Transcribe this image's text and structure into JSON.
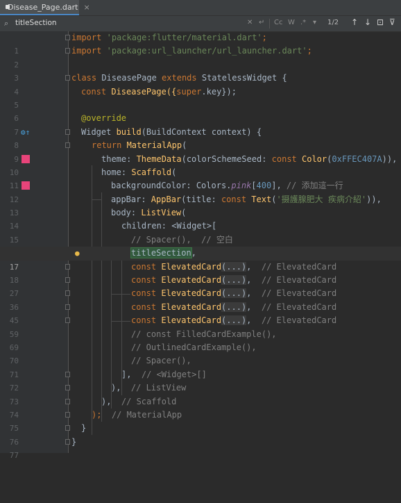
{
  "tab": {
    "filename": "Disease_Page.dart",
    "close": "×"
  },
  "search": {
    "query": "titleSection",
    "match_count": "1/2",
    "opts": {
      "cc": "Cc",
      "w": "W",
      "regex": ".*"
    }
  },
  "editor": {
    "lines": [
      {
        "n": "1"
      },
      {
        "n": "2"
      },
      {
        "n": "3"
      },
      {
        "n": "4"
      },
      {
        "n": "5"
      },
      {
        "n": "6"
      },
      {
        "n": "7"
      },
      {
        "n": "8"
      },
      {
        "n": "9"
      },
      {
        "n": "10"
      },
      {
        "n": "11"
      },
      {
        "n": "12"
      },
      {
        "n": "13"
      },
      {
        "n": "14"
      },
      {
        "n": "15"
      },
      {
        "n": "16"
      },
      {
        "n": "17"
      },
      {
        "n": "18"
      },
      {
        "n": "27"
      },
      {
        "n": "36"
      },
      {
        "n": "45"
      },
      {
        "n": "59"
      },
      {
        "n": "69"
      },
      {
        "n": "70"
      },
      {
        "n": "71"
      },
      {
        "n": "72"
      },
      {
        "n": "73"
      },
      {
        "n": "74"
      },
      {
        "n": "75"
      },
      {
        "n": "76"
      },
      {
        "n": "77"
      }
    ],
    "code": {
      "l1": {
        "kw": "import",
        "str": "'package:flutter/material.dart'",
        "end": ";"
      },
      "l2": {
        "kw": "import",
        "str": "'package:url_launcher/url_launcher.dart'",
        "end": ";"
      },
      "l4": {
        "kw1": "class",
        "name": " DiseasePage ",
        "kw2": "extends",
        "rest": " StatelessWidget {"
      },
      "l5": {
        "kw": "const",
        "name": " DiseasePage({",
        "sup": "super",
        "rest": ".key});"
      },
      "l7": {
        "ann": "@override"
      },
      "l8": {
        "a": "Widget ",
        "fn": "build",
        "b": "(BuildContext context) {"
      },
      "l9": {
        "kw": "return",
        "cls": " MaterialApp",
        "b": "("
      },
      "l10": {
        "a": "theme: ",
        "cls": "ThemeData",
        "b": "(colorSchemeSeed: ",
        "kw": "const",
        "cls2": " Color",
        "c": "(",
        "num": "0xFFEC407A",
        "d": ")),"
      },
      "l11": {
        "a": "home: ",
        "cls": "Scaffold",
        "b": "("
      },
      "l12": {
        "a": "backgroundColor: Colors.",
        "field": "pink",
        "b": "[",
        "num": "400",
        "c": "], ",
        "cm": "// 添加這一行"
      },
      "l13": {
        "a": "appBar: ",
        "cls": "AppBar",
        "b": "(title: ",
        "kw": "const",
        "cls2": " Text",
        "c": "(",
        "str": "'摄護腺肥大 疾病介紹'",
        "d": ")),"
      },
      "l14": {
        "a": "body: ",
        "cls": "ListView",
        "b": "("
      },
      "l15": {
        "a": "children: <Widget>["
      },
      "l16": {
        "cm": "// Spacer(),  // 空白"
      },
      "l17": {
        "hl": "titleSection",
        "b": ","
      },
      "cards": {
        "kw": "const",
        "cls": " ElevatedCard",
        "ph": "(...)",
        "b": ",  ",
        "cm": "// ElevatedCard"
      },
      "l69": {
        "cm": "// const FilledCardExample(),"
      },
      "l70": {
        "cm": "// OutlinedCardExample(),"
      },
      "l71": {
        "cm": "// Spacer(),"
      },
      "l72": {
        "a": "],  ",
        "cm": "// <Widget>[]"
      },
      "l73": {
        "a": "),  ",
        "cm": "// ListView"
      },
      "l74": {
        "a": "),  ",
        "cm": "// Scaffold"
      },
      "l75": {
        "a": ");  ",
        "cm": "// MaterialApp"
      },
      "l76": {
        "a": "}"
      },
      "l77": {
        "a": "}"
      }
    }
  },
  "colors": {
    "background": "#2b2b2b",
    "gutter": "#313335",
    "keyword": "#cc7832",
    "string": "#6a8759",
    "comment": "#808080",
    "class": "#ffc66d",
    "number": "#6897bb",
    "annotation": "#bbb529",
    "marker": "#e8447a"
  }
}
